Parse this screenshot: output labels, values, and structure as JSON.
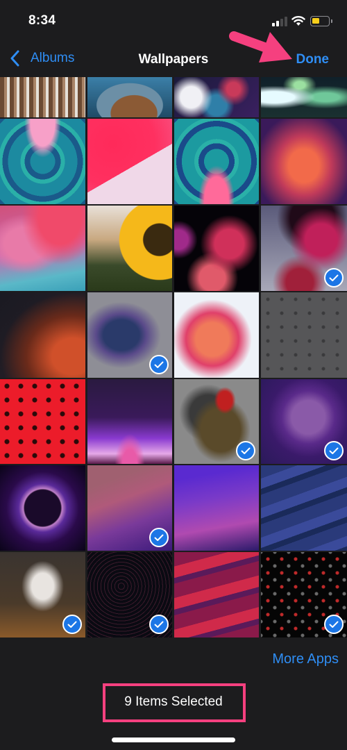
{
  "status_bar": {
    "time": "8:34",
    "signal_icon": "cellular-signal-icon",
    "signal_bars_active": 2,
    "signal_bars_total": 4,
    "wifi_icon": "wifi-icon",
    "battery_icon": "battery-icon",
    "battery_level": 0.45,
    "battery_color": "#f7ce1a"
  },
  "nav": {
    "back_label": "Albums",
    "back_icon": "chevron-left-icon",
    "title": "Wallpapers",
    "done_label": "Done"
  },
  "annotation": {
    "arrow_icon": "arrow-pointer-icon",
    "color": "#f5407f"
  },
  "accent_color": "#2f8ef5",
  "selected_badge_color": "#1c76e6",
  "grid": {
    "columns": 4,
    "rows": [
      [
        {
          "name": "wood-architecture",
          "selected": false
        },
        {
          "name": "hooded-figure",
          "selected": false
        },
        {
          "name": "fluid-marble",
          "selected": false
        },
        {
          "name": "green-smoke",
          "selected": false
        }
      ],
      [
        {
          "name": "ios-bubble-pink-teal",
          "selected": false
        },
        {
          "name": "ios14-red-pink",
          "selected": false
        },
        {
          "name": "ios-bubble-teal-pink",
          "selected": false
        },
        {
          "name": "gradient-orange-purple",
          "selected": false
        }
      ],
      [
        {
          "name": "watercolor-pink-teal",
          "selected": false
        },
        {
          "name": "sunflower",
          "selected": false
        },
        {
          "name": "dark-bubbles-red",
          "selected": false
        },
        {
          "name": "light-bubbles-red",
          "selected": true
        }
      ],
      [
        {
          "name": "dark-red-dust",
          "selected": false
        },
        {
          "name": "paint-splash-blue",
          "selected": true
        },
        {
          "name": "paint-splash-orange",
          "selected": false
        },
        {
          "name": "gray-pattern",
          "selected": false
        }
      ],
      [
        {
          "name": "red-pattern",
          "selected": false
        },
        {
          "name": "purple-dusk",
          "selected": false
        },
        {
          "name": "deadpool-wolverine",
          "selected": true
        },
        {
          "name": "purple-orb-light",
          "selected": true
        }
      ],
      [
        {
          "name": "purple-orb-dark",
          "selected": false
        },
        {
          "name": "monterey-light",
          "selected": true
        },
        {
          "name": "monterey-dark",
          "selected": false
        },
        {
          "name": "blue-waves",
          "selected": false
        }
      ],
      [
        {
          "name": "volcano-smoke",
          "selected": true
        },
        {
          "name": "topographic-dark",
          "selected": true
        },
        {
          "name": "red-waves",
          "selected": false
        },
        {
          "name": "black-red-pattern",
          "selected": true
        }
      ]
    ]
  },
  "toolbar": {
    "more_apps_label": "More Apps",
    "selected_count_label": "9 Items Selected"
  }
}
